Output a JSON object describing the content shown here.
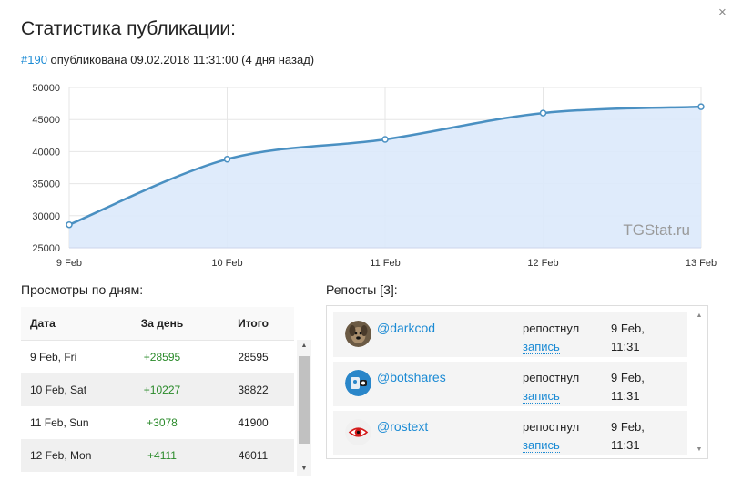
{
  "dialog": {
    "close_label": "×",
    "title": "Статистика публикации:",
    "post_id": "#190",
    "published_text": " опубликована 09.02.2018 11:31:00 (4 дня назад)"
  },
  "chart_data": {
    "type": "area",
    "x": [
      "9 Feb",
      "10 Feb",
      "11 Feb",
      "12 Feb",
      "13 Feb"
    ],
    "values": [
      28595,
      38822,
      41900,
      46011,
      47000
    ],
    "yticks": [
      "50000",
      "45000",
      "40000",
      "35000",
      "30000",
      "25000"
    ],
    "ylim": [
      25000,
      50000
    ],
    "watermark": "TGStat.ru",
    "line_color": "#4a90c2",
    "fill_color": "#dbe9fb",
    "grid": true
  },
  "daily_views": {
    "title": "Просмотры по дням:",
    "headers": [
      "Дата",
      "За день",
      "Итого"
    ],
    "rows": [
      {
        "date": "9 Feb, Fri",
        "per_day": "+28595",
        "total": "28595"
      },
      {
        "date": "10 Feb, Sat",
        "per_day": "+10227",
        "total": "38822"
      },
      {
        "date": "11 Feb, Sun",
        "per_day": "+3078",
        "total": "41900"
      },
      {
        "date": "12 Feb, Mon",
        "per_day": "+4111",
        "total": "46011"
      }
    ]
  },
  "reposts": {
    "title": "Репосты [3]:",
    "items": [
      {
        "name": "@darkcod",
        "action": "репостнул",
        "link": "запись",
        "date": "9 Feb,",
        "time": "11:31",
        "avatar": "dog-avatar"
      },
      {
        "name": "@botshares",
        "action": "репостнул",
        "link": "запись",
        "date": "9 Feb,",
        "time": "11:31",
        "avatar": "robot-avatar"
      },
      {
        "name": "@rostext",
        "action": "репостнул",
        "link": "запись",
        "date": "9 Feb,",
        "time": "11:31",
        "avatar": "eye-avatar"
      }
    ]
  }
}
